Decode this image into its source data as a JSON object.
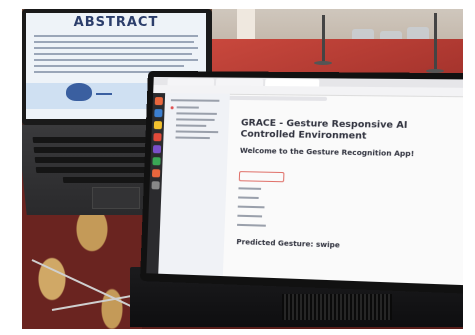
{
  "back_screen": {
    "heading": "ABSTRACT"
  },
  "front_screen": {
    "app_title": "GRACE - Gesture Responsive AI Controlled Environment",
    "welcome_heading": "Welcome to the Gesture Recognition App!",
    "predicted_label": "Predicted Gesture: swipe"
  },
  "colors": {
    "carpet": "#a8352e",
    "streamlit_text": "#31333f",
    "accent_red": "#e0716a"
  }
}
